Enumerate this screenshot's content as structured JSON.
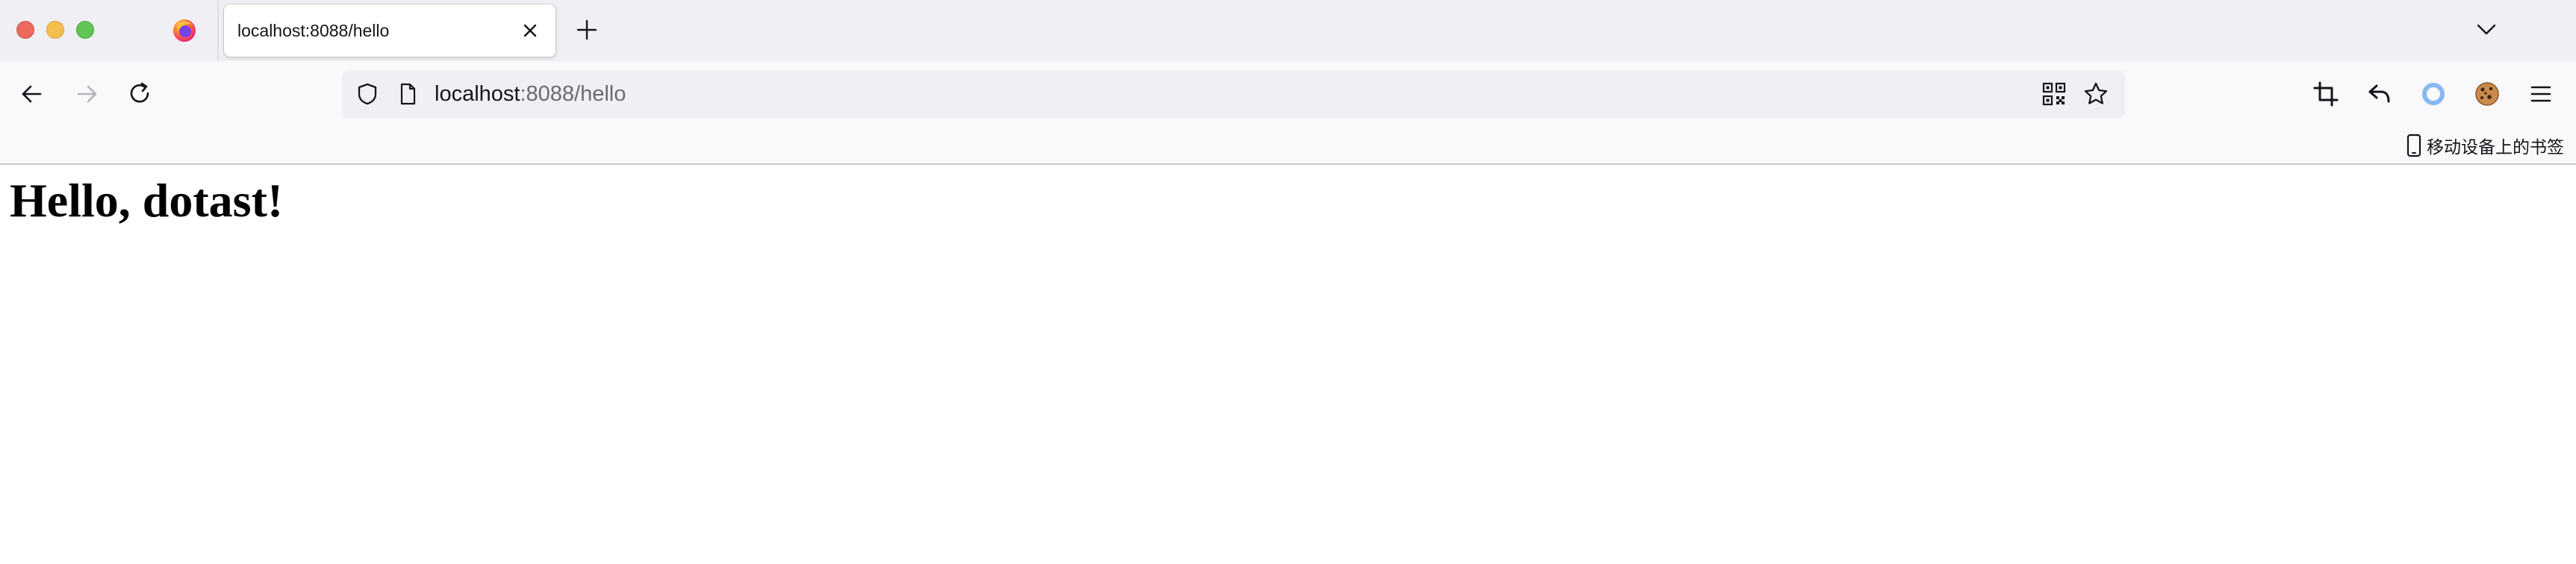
{
  "browser": {
    "tab": {
      "title": "localhost:8088/hello"
    },
    "url": {
      "host": "localhost",
      "path": ":8088/hello"
    },
    "bookmarks": {
      "mobile_label": "移动设备上的书签"
    },
    "icons": {
      "window_close": "traffic-light-close",
      "window_minimize": "traffic-light-minimize",
      "window_maximize": "traffic-light-maximize",
      "firefox_logo": "firefox-logo-icon",
      "tab_close": "close-icon",
      "new_tab": "plus-icon",
      "tab_list": "chevron-down-icon",
      "back": "arrow-left-icon",
      "forward": "arrow-right-icon",
      "reload": "reload-icon",
      "tracking_protection": "shield-icon",
      "page_info": "page-icon",
      "qr_code": "qr-code-icon",
      "bookmark_star": "star-icon",
      "screenshot": "crop-icon",
      "undo": "undo-icon",
      "extension": "ring-icon",
      "cookie_extension": "cookie-icon",
      "menu": "hamburger-menu-icon",
      "mobile": "mobile-device-icon"
    },
    "colors": {
      "tabstrip": "#f0f0f4",
      "toolbar": "#f9f9fb",
      "url_path": "#6a6a72",
      "close": "#ec6a5e",
      "minimize": "#f4bf4f",
      "maximize": "#61c554",
      "extension_ring": "#87b8f0"
    }
  },
  "page": {
    "heading": "Hello, dotast!"
  }
}
